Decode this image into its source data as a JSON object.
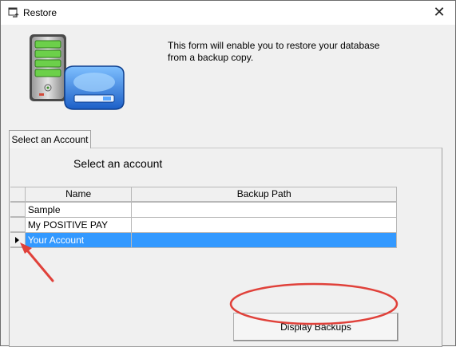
{
  "window": {
    "title": "Restore",
    "close_glyph": "✕"
  },
  "intro_text": "This form will enable you to restore your database from a backup copy.",
  "tab": {
    "label": "Select an Account"
  },
  "panel": {
    "heading": "Select an account"
  },
  "grid": {
    "columns": [
      "Name",
      "Backup Path"
    ],
    "rows": [
      {
        "name": "Sample",
        "path": ""
      },
      {
        "name": "My POSITIVE PAY",
        "path": ""
      },
      {
        "name": "Your Account",
        "path": ""
      }
    ],
    "selected_index": 2
  },
  "buttons": {
    "display_backups": "Display Backups"
  },
  "icons": {
    "title": "restore-app-icon",
    "hero": "server-and-drive-icon",
    "close": "close-icon",
    "row_pointer": "row-pointer-icon"
  },
  "colors": {
    "selection": "#3399ff",
    "annotation": "#e0413a"
  }
}
